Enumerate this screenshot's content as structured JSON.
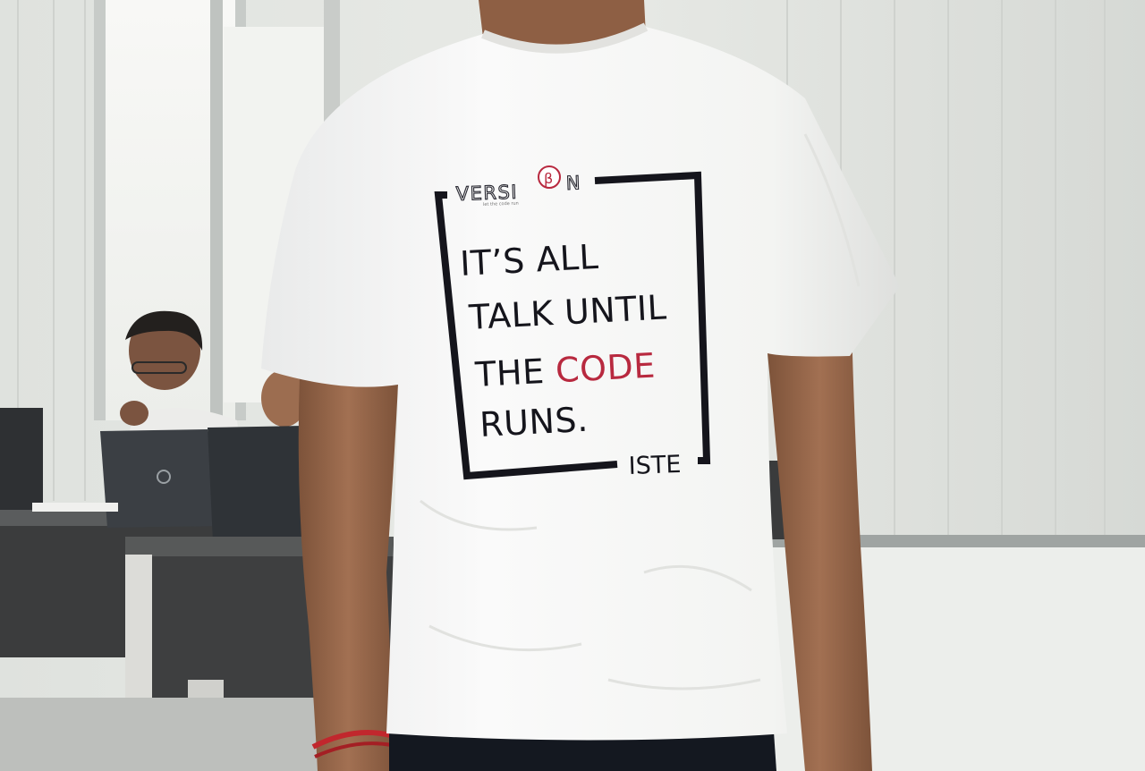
{
  "shirt": {
    "brand": {
      "prefix": "VERSI",
      "suffix": "N",
      "tagline": "let the code run"
    },
    "slogan": {
      "line1": "IT’S ALL",
      "line2": "TALK UNTIL",
      "line3_prefix": "THE ",
      "line3_highlight": "CODE",
      "line4": "RUNS."
    },
    "signature": "ISTE"
  },
  "colors": {
    "wall": "#e6e8e4",
    "shirt": "#f7f7f4",
    "ink": "#15151c",
    "accent": "#b8293f",
    "skin": "#9a6a4e",
    "laptop": "#33373c"
  }
}
